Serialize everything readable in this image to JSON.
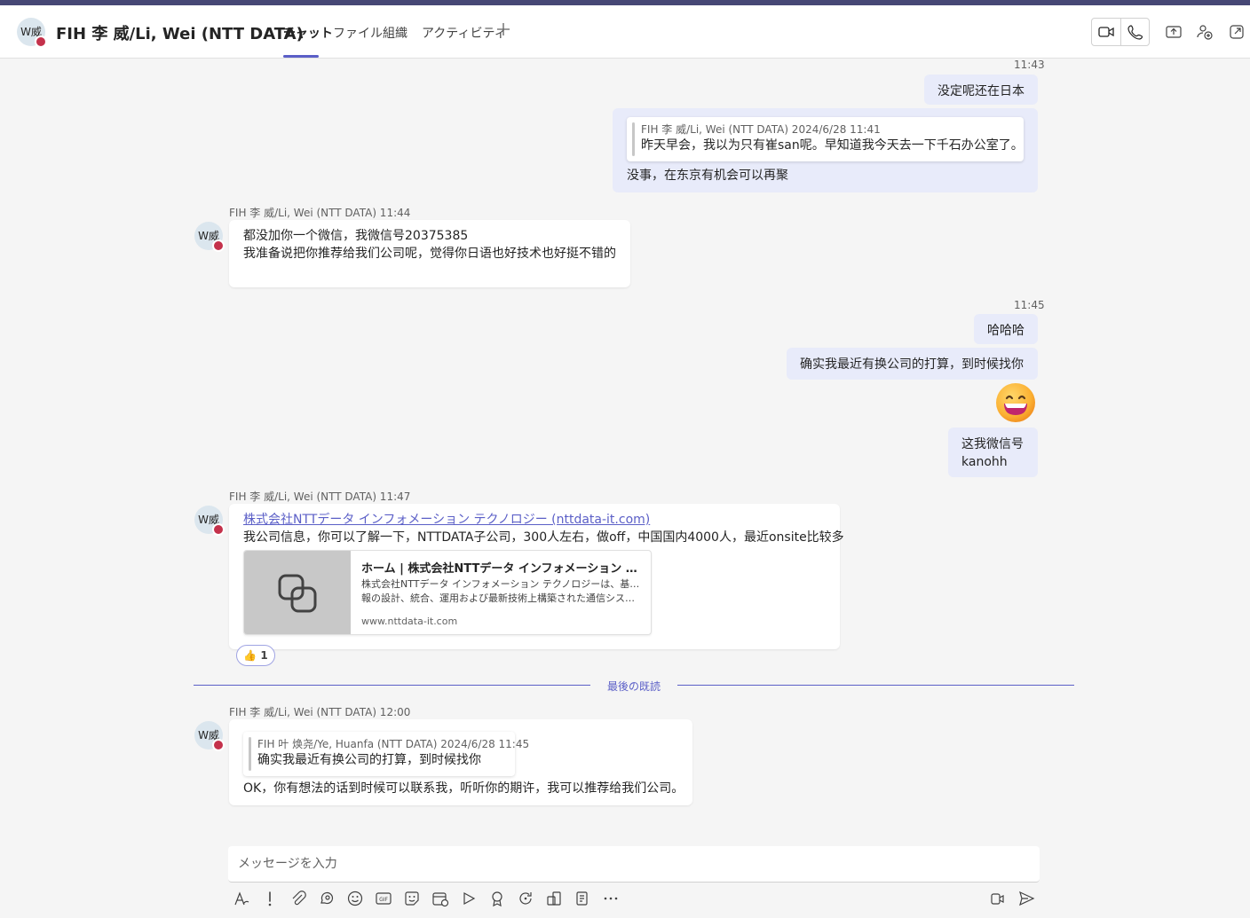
{
  "header": {
    "avatar_initials": "W威",
    "title": "FIH 李 威/Li, Wei (NTT DATA)",
    "tabs": [
      {
        "label": "チャット",
        "active": true
      },
      {
        "label": "ファイル"
      },
      {
        "label": "組織"
      },
      {
        "label": "アクティビティ"
      }
    ],
    "actions": [
      "video-call-icon",
      "audio-call-icon",
      "share-screen-icon",
      "add-people-icon",
      "pop-out-icon"
    ]
  },
  "messages": {
    "me1": {
      "time": "11:43",
      "text": "没定呢还在日本"
    },
    "me2": {
      "quote_head": "FIH 李 威/Li, Wei (NTT DATA)   2024/6/28 11:41",
      "quote_text": "昨天早会，我以为只有崔san呢。早知道我今天去一下千石办公室了。",
      "text": "没事，在东京有机会可以再聚"
    },
    "them1": {
      "sender": "FIH 李 威/Li, Wei (NTT DATA)   11:44",
      "line1": "都没加你一个微信，我微信号20375385",
      "line2": "我准备说把你推荐给我们公司呢，觉得你日语也好技术也好挺不错的"
    },
    "me3": {
      "time": "11:45",
      "text": "哈哈哈"
    },
    "me4": {
      "text": "确实我最近有换公司的打算，到时候找你"
    },
    "me5": {
      "emoji": "grinning-face-emoji"
    },
    "me6": {
      "line1": "这我微信号",
      "line2": "kanohh"
    },
    "them2": {
      "sender": "FIH 李 威/Li, Wei (NTT DATA)   11:47",
      "link": "株式会社NTTデータ インフォメーション テクノロジー (nttdata-it.com)",
      "text": "我公司信息，你可以了解一下，NTTDATA子公司，300人左右，做off，中国国内4000人，最近onsite比较多",
      "preview_title": "ホーム | 株式会社NTTデータ インフォメーション テクノロジー",
      "preview_desc1": "株式会社NTTデータ インフォメーション テクノロジーは、基幹業務情",
      "preview_desc2": "報の設計、統合、運用および最新技術上構築された通信システム",
      "preview_url": "www.nttdata-it.com",
      "reaction_emoji": "👍",
      "reaction_count": "1"
    },
    "last_read_label": "最後の既読",
    "them3": {
      "sender": "FIH 李 威/Li, Wei (NTT DATA)   12:00",
      "quote_head": "FIH 叶 焕尧/Ye, Huanfa (NTT DATA)   2024/6/28 11:45",
      "quote_text": "确实我最近有换公司的打算，到时候找你",
      "text": "OK，你有想法的话到时候可以联系我，听听你的期许，我可以推荐给我们公司。"
    }
  },
  "compose": {
    "placeholder": "メッセージを入力",
    "tools": [
      "format-icon",
      "important-icon",
      "attach-icon",
      "loop-icon",
      "emoji-icon",
      "gif-icon",
      "sticker-icon",
      "schedule-meeting-icon",
      "stream-icon",
      "praise-icon",
      "updates-icon",
      "apps-icon",
      "approvals-icon",
      "more-icon"
    ],
    "right_tools": [
      "dictate-icon",
      "send-icon"
    ]
  },
  "colors": {
    "accent": "#5b5fc7",
    "top_bar": "#464775",
    "my_bubble": "#e8ebfa",
    "presence_busy": "#c4314b"
  }
}
